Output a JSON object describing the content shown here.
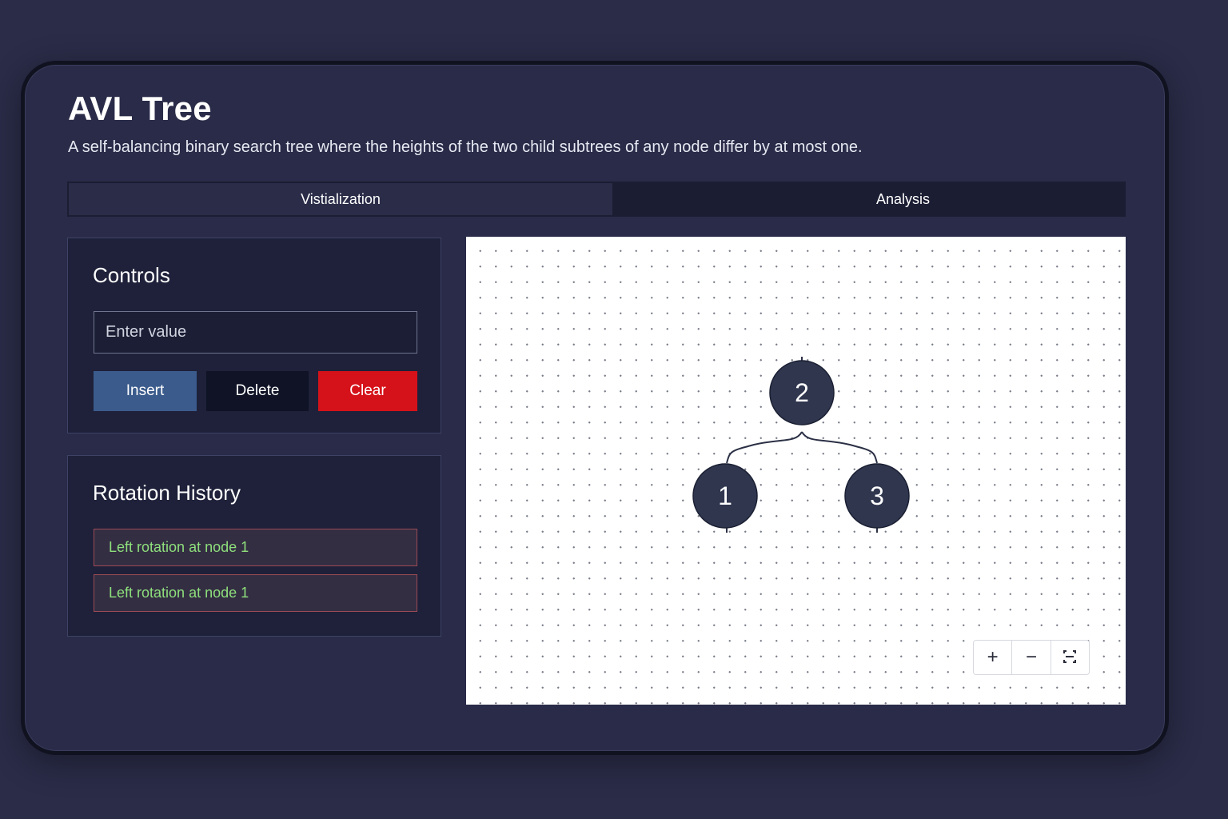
{
  "header": {
    "title": "AVL Tree",
    "subtitle": "A self-balancing binary search tree where the heights of the two child subtrees of any node differ by at most one."
  },
  "tabs": [
    {
      "label": "Vistialization",
      "active": true
    },
    {
      "label": "Analysis",
      "active": false
    }
  ],
  "controls": {
    "title": "Controls",
    "input_placeholder": "Enter value",
    "input_value": "",
    "insert_label": "Insert",
    "delete_label": "Delete",
    "clear_label": "Clear"
  },
  "history": {
    "title": "Rotation History",
    "items": [
      "Left rotation at node 1",
      "Left rotation at node 1"
    ]
  },
  "tree": {
    "root": {
      "value": "2",
      "left": {
        "value": "1"
      },
      "right": {
        "value": "3"
      }
    }
  },
  "zoom_controls": [
    {
      "name": "zoom-in",
      "glyph": "+"
    },
    {
      "name": "zoom-out",
      "glyph": "−"
    },
    {
      "name": "fit-view",
      "icon": "fit-view-icon"
    }
  ],
  "colors": {
    "background": "#2a2c48",
    "insert_button": "#3b5b8c",
    "delete_button": "#0f1325",
    "clear_button": "#d5121a",
    "history_text": "#8ee07c",
    "node_fill": "#2f364e"
  }
}
